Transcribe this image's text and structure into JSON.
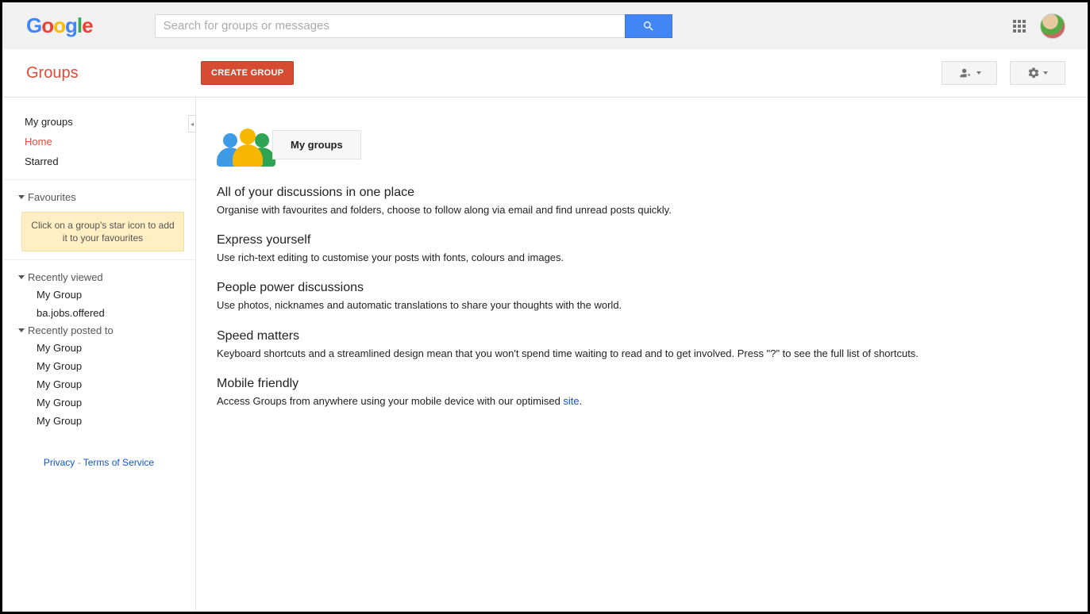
{
  "header": {
    "search_placeholder": "Search for groups or messages"
  },
  "app": {
    "title": "Groups",
    "create_button": "CREATE GROUP"
  },
  "sidebar": {
    "primary": [
      {
        "label": "My groups",
        "active": false
      },
      {
        "label": "Home",
        "active": true
      },
      {
        "label": "Starred",
        "active": false
      }
    ],
    "favourites_header": "Favourites",
    "favourites_hint": "Click on a group's star icon to add it to your favourites",
    "recently_viewed_header": "Recently viewed",
    "recently_viewed": [
      "My Group",
      "ba.jobs.offered"
    ],
    "recently_posted_header": "Recently posted to",
    "recently_posted": [
      "My Group",
      "My Group",
      "My Group",
      "My Group",
      "My Group"
    ],
    "footer": {
      "privacy": "Privacy",
      "tos": "Terms of Service"
    }
  },
  "content": {
    "heading": "My groups",
    "blocks": [
      {
        "title": "All of your discussions in one place",
        "body": "Organise with favourites and folders, choose to follow along via email and find unread posts quickly."
      },
      {
        "title": "Express yourself",
        "body": "Use rich-text editing to customise your posts with fonts, colours and images."
      },
      {
        "title": "People power discussions",
        "body": "Use photos, nicknames and automatic translations to share your thoughts with the world."
      },
      {
        "title": "Speed matters",
        "body": "Keyboard shortcuts and a streamlined design mean that you won't spend time waiting to read and to get involved. Press \"?\" to see the full list of shortcuts."
      },
      {
        "title": "Mobile friendly",
        "body_pre": "Access Groups from anywhere using your mobile device with our optimised ",
        "link": "site",
        "body_post": "."
      }
    ]
  }
}
